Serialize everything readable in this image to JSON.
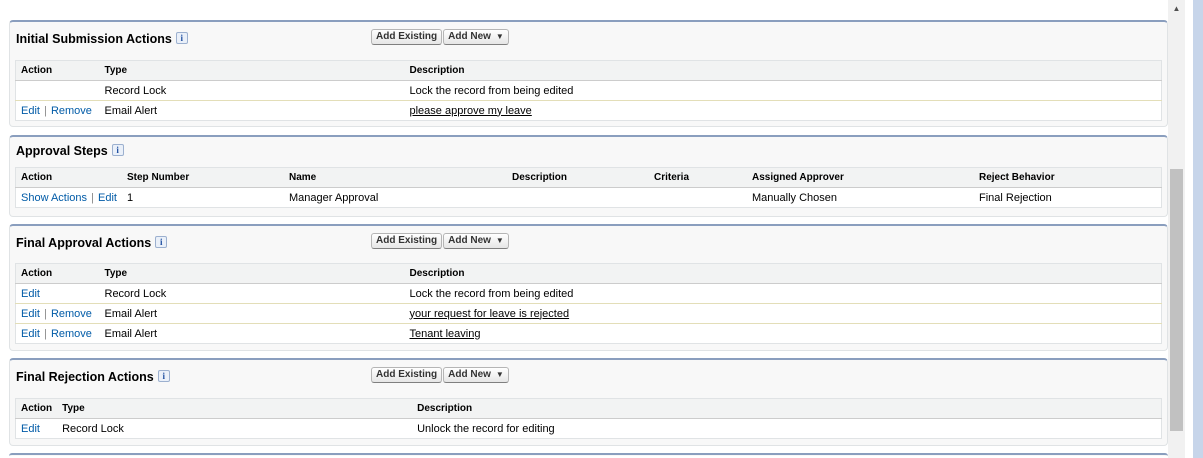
{
  "initial_submission": {
    "title": "Initial Submission Actions",
    "add_existing": "Add Existing",
    "add_new": "Add New",
    "headers": [
      "Action",
      "Type",
      "Description"
    ],
    "rows": [
      {
        "edit": "",
        "remove": "",
        "type": "Record Lock",
        "description": "Lock the record from being edited"
      },
      {
        "edit": "Edit",
        "remove": "Remove",
        "type": "Email Alert",
        "description": "please approve my leave"
      }
    ]
  },
  "approval_steps": {
    "title": "Approval Steps",
    "headers": [
      "Action",
      "Step Number",
      "Name",
      "Description",
      "Criteria",
      "Assigned Approver",
      "Reject Behavior"
    ],
    "rows": [
      {
        "show_actions": "Show Actions",
        "edit": "Edit",
        "step_number": "1",
        "name": "Manager Approval",
        "description": "",
        "criteria": "",
        "assigned_approver": "Manually Chosen",
        "reject_behavior": "Final Rejection"
      }
    ]
  },
  "final_approval": {
    "title": "Final Approval Actions",
    "add_existing": "Add Existing",
    "add_new": "Add New",
    "headers": [
      "Action",
      "Type",
      "Description"
    ],
    "rows": [
      {
        "edit": "Edit",
        "remove": "",
        "type": "Record Lock",
        "description": "Lock the record from being edited"
      },
      {
        "edit": "Edit",
        "remove": "Remove",
        "type": "Email Alert",
        "description": "your request for leave is rejected"
      },
      {
        "edit": "Edit",
        "remove": "Remove",
        "type": "Email Alert",
        "description": "Tenant leaving"
      }
    ]
  },
  "final_rejection": {
    "title": "Final Rejection Actions",
    "add_existing": "Add Existing",
    "add_new": "Add New",
    "headers": [
      "Action",
      "Type",
      "Description"
    ],
    "rows": [
      {
        "edit": "Edit",
        "type": "Record Lock",
        "description": "Unlock the record for editing"
      }
    ]
  },
  "icons": {
    "info": "i",
    "dropdown": "▼",
    "scroll_up": "▲"
  },
  "colors": {
    "link": "#015ba7",
    "section_border": "#8a9ebe",
    "header_bg": "#f2f3f3"
  }
}
